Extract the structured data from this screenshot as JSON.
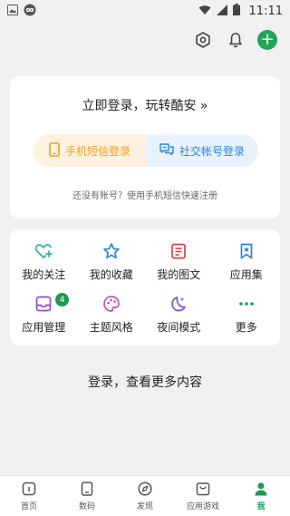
{
  "status_bar": {
    "time": "11:11"
  },
  "login_card": {
    "title": "立即登录，玩转酷安 »",
    "sms_button": "手机短信登录",
    "social_button": "社交帐号登录",
    "hint": "还没有账号？使用手机短信快速注册"
  },
  "shortcuts": [
    {
      "label": "我的关注",
      "icon": "heart-plus-icon",
      "color": "#27b3b3"
    },
    {
      "label": "我的收藏",
      "icon": "star-icon",
      "color": "#2a84d6"
    },
    {
      "label": "我的图文",
      "icon": "document-icon",
      "color": "#e04040"
    },
    {
      "label": "应用集",
      "icon": "bookmark-icon",
      "color": "#2a84d6"
    },
    {
      "label": "应用管理",
      "icon": "inbox-icon",
      "color": "#8a4fc7",
      "badge": "4"
    },
    {
      "label": "主题风格",
      "icon": "palette-icon",
      "color": "#d04aa8"
    },
    {
      "label": "夜间模式",
      "icon": "moon-icon",
      "color": "#7a56d8"
    },
    {
      "label": "更多",
      "icon": "more-dots-icon",
      "color": "#1e9a55"
    }
  ],
  "prompt": "登录，查看更多内容",
  "bottom_nav": [
    {
      "label": "首页",
      "icon": "home-icon"
    },
    {
      "label": "数码",
      "icon": "phone-icon"
    },
    {
      "label": "发现",
      "icon": "compass-icon"
    },
    {
      "label": "应用游戏",
      "icon": "store-icon"
    },
    {
      "label": "我",
      "icon": "person-icon",
      "active": true
    }
  ],
  "colors": {
    "accent": "#1e9a55",
    "background": "#f1f1f3"
  }
}
